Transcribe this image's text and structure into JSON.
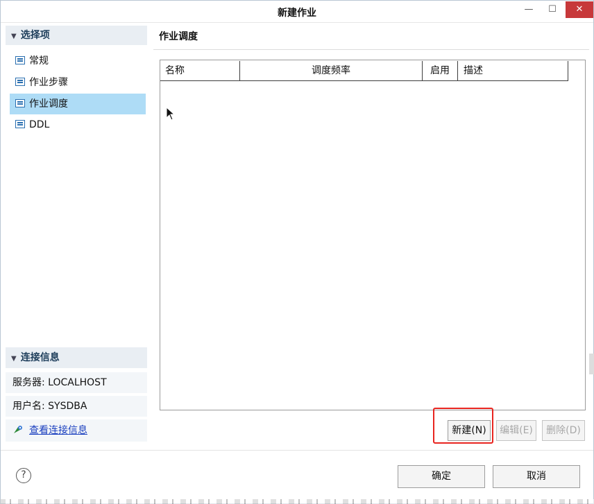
{
  "window": {
    "title": "新建作业",
    "min_glyph": "—",
    "max_glyph": "☐",
    "close_glyph": "✕"
  },
  "nav": {
    "header": "选择项",
    "items": [
      {
        "label": "常规"
      },
      {
        "label": "作业步骤"
      },
      {
        "label": "作业调度"
      },
      {
        "label": "DDL"
      }
    ],
    "selected": "作业调度"
  },
  "connection": {
    "header": "连接信息",
    "server": "服务器: LOCALHOST",
    "user": "用户名: SYSDBA",
    "link": "查看连接信息"
  },
  "main": {
    "title": "作业调度",
    "columns": [
      "名称",
      "调度频率",
      "启用",
      "描述"
    ],
    "rows": []
  },
  "buttons": {
    "new": "新建(N)",
    "edit": "编辑(E)",
    "delete": "删除(D)",
    "ok": "确定",
    "cancel": "取消",
    "help": "?"
  },
  "colors": {
    "selected": "#aedcf6",
    "close": "#c7383a",
    "highlight": "#e8241f",
    "link": "#1a3fbf"
  }
}
